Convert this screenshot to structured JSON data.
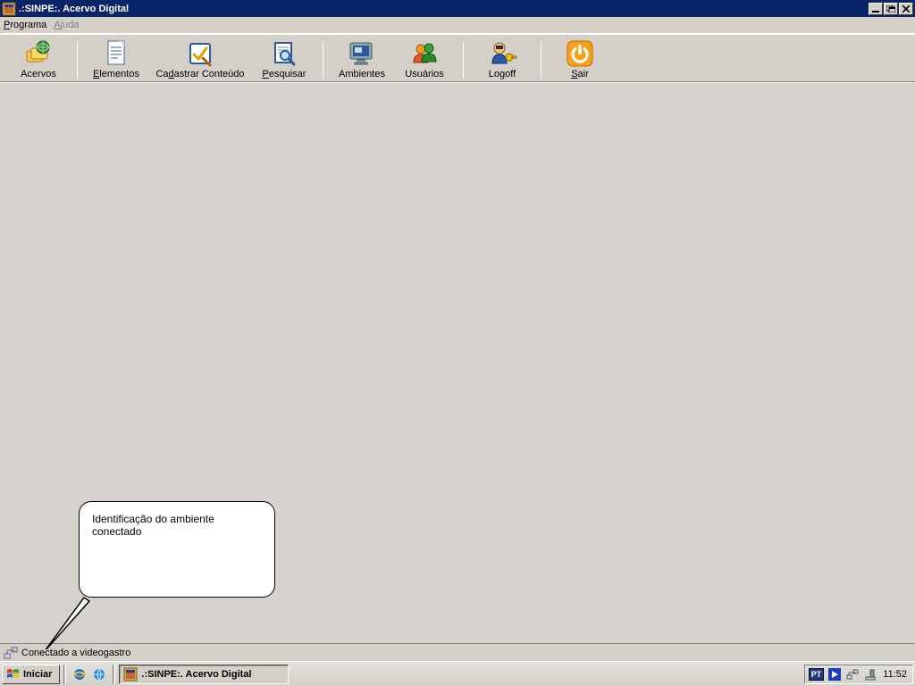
{
  "title": ".:SINPE:. Acervo Digital",
  "menubar": {
    "programa_pre": "P",
    "programa_post": "rograma",
    "ajuda_pre": "A",
    "ajuda_post": "juda"
  },
  "toolbar": {
    "acervos": "Acervos",
    "elementos_pre": "E",
    "elementos_post": "lementos",
    "cadastrar_pre": "Ca",
    "cadastrar_ul": "d",
    "cadastrar_post": "astrar Conteúdo",
    "pesquisar_pre": "P",
    "pesquisar_post": "esquisar",
    "ambientes": "Ambientes",
    "usuarios": "Usuários",
    "logoff": "Logoff",
    "sair_pre": "S",
    "sair_post": "air"
  },
  "callout": "Identificação do ambiente conectado",
  "status": "Conectado a videogastro",
  "taskbar": {
    "start": "Iniciar",
    "task1": ".:SINPE:. Acervo Digital",
    "lang": "PT",
    "clock": "11:52"
  }
}
